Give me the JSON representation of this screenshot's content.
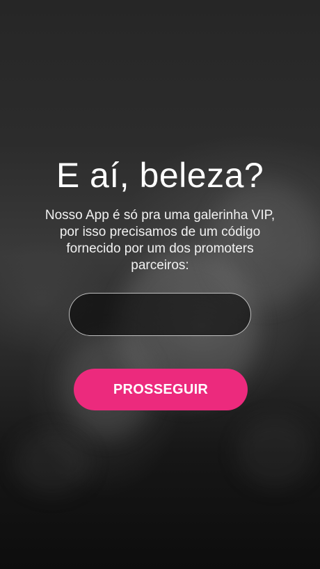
{
  "welcome": {
    "title": "E aí, beleza?",
    "description": "Nosso App é só pra uma galerinha VIP, por isso precisamos de um código fornecido por um dos promoters parceiros:"
  },
  "code_field": {
    "value": "",
    "placeholder": ""
  },
  "actions": {
    "continue_label": "PROSSEGUIR"
  },
  "colors": {
    "accent": "#ec2a7d",
    "background": "#1e1e1e",
    "text": "#ffffff"
  }
}
